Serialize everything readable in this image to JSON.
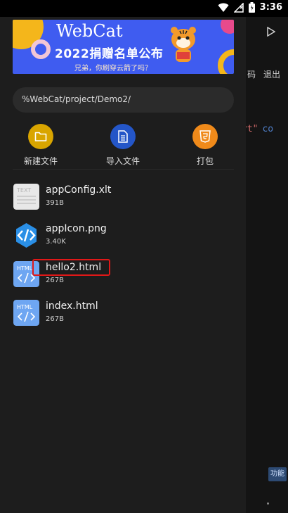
{
  "status_bar": {
    "time": "3:36"
  },
  "banner": {
    "title": "WebCat",
    "subtitle": "2022捐赠名单公布",
    "note": "兄弟，你刷穿云箭了吗？"
  },
  "path_field": {
    "value": "%WebCat/project/Demo2/"
  },
  "actions": [
    {
      "label": "新建文件",
      "icon": "folder-icon",
      "color": "#d9a500"
    },
    {
      "label": "导入文件",
      "icon": "document-icon",
      "color": "#2456c8"
    },
    {
      "label": "打包",
      "icon": "html5-icon",
      "color": "#f08a1a"
    }
  ],
  "files": [
    {
      "name": "appConfig.xlt",
      "size": "391B",
      "icon": "text-file-icon"
    },
    {
      "name": "appIcon.png",
      "size": "3.40K",
      "icon": "image-file-icon"
    },
    {
      "name": "hello2.html",
      "size": "267B",
      "icon": "html-file-icon"
    },
    {
      "name": "index.html",
      "size": "267B",
      "icon": "html-file-icon"
    }
  ],
  "editor_bg": {
    "menu_partial": "码",
    "menu_exit": "退出",
    "code_fragment": "rt\"",
    "code_keyword": "co",
    "func_label": "功能"
  },
  "colors": {
    "highlight": "#e01818",
    "drawer_bg": "#1d1d1d",
    "banner_bg": "#3f5cf0"
  }
}
